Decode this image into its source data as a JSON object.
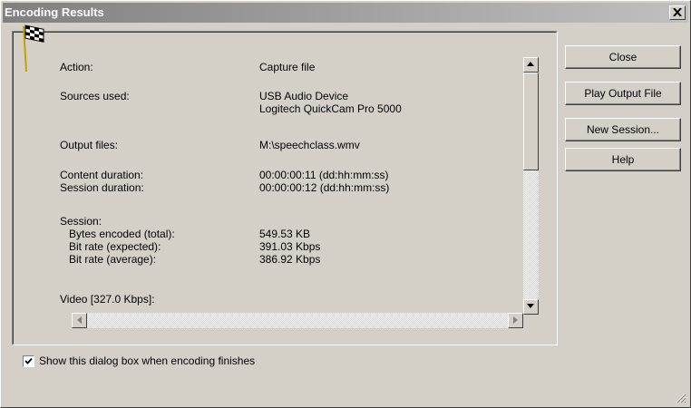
{
  "window": {
    "title": "Encoding Results",
    "close_glyph": "✕"
  },
  "buttons": {
    "close": "Close",
    "play_output": "Play Output File",
    "new_session": "New Session...",
    "help": "Help"
  },
  "results": {
    "action_label": "Action:",
    "action_value": "Capture file",
    "sources_label": "Sources used:",
    "sources_value_1": "USB Audio Device",
    "sources_value_2": "Logitech QuickCam Pro 5000",
    "output_label": "Output files:",
    "output_value": "M:\\speechclass.wmv",
    "content_duration_label": "Content duration:",
    "content_duration_value": "00:00:00:11  (dd:hh:mm:ss)",
    "session_duration_label": "Session duration:",
    "session_duration_value": "00:00:00:12  (dd:hh:mm:ss)",
    "session_label": "Session:",
    "bytes_label": "Bytes encoded (total):",
    "bytes_value": "549.53 KB",
    "bitrate_expected_label": "Bit rate (expected):",
    "bitrate_expected_value": "391.03 Kbps",
    "bitrate_average_label": "Bit rate (average):",
    "bitrate_average_value": "386.92 Kbps",
    "video_label": "Video [327.0 Kbps]:"
  },
  "checkbox": {
    "label": "Show this dialog box when encoding finishes",
    "checked": true
  }
}
